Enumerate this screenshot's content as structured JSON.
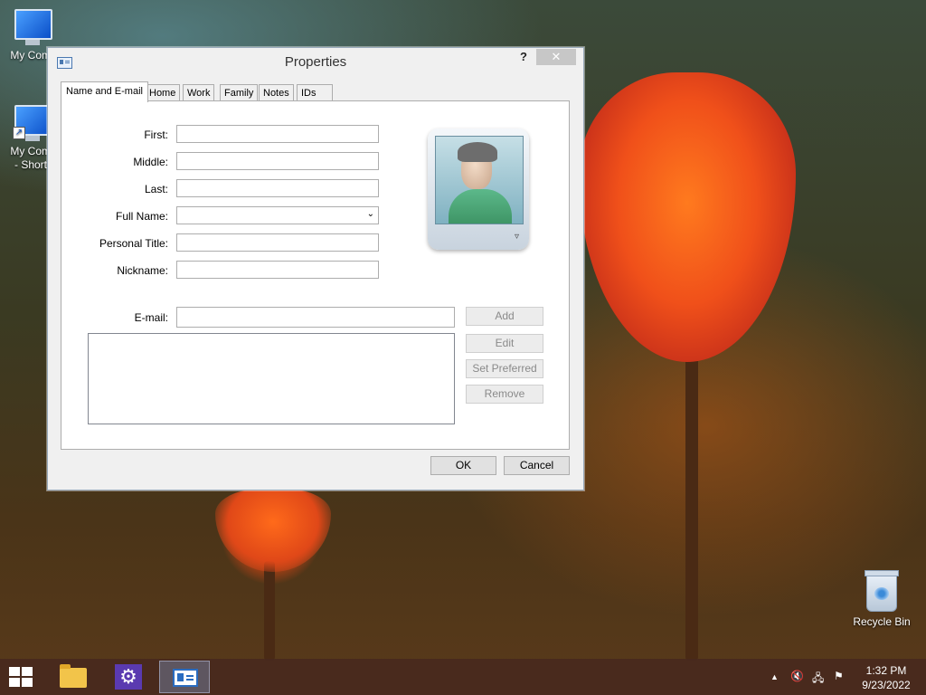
{
  "desktop": {
    "icons": [
      {
        "label": "My Comp"
      },
      {
        "label_line1": "My Comp",
        "label_line2": "- Shortc"
      },
      {
        "label": "Recycle Bin"
      }
    ]
  },
  "dialog": {
    "title": "Properties",
    "help_glyph": "?",
    "close_glyph": "✕",
    "tabs": [
      {
        "label": "Name and E-mail",
        "active": true
      },
      {
        "label": "Home"
      },
      {
        "label": "Work"
      },
      {
        "label": "Family"
      },
      {
        "label": "Notes"
      },
      {
        "label": "IDs"
      }
    ],
    "fields": {
      "first": {
        "label": "First:",
        "value": ""
      },
      "middle": {
        "label": "Middle:",
        "value": ""
      },
      "last": {
        "label": "Last:",
        "value": ""
      },
      "full_name": {
        "label": "Full Name:",
        "value": ""
      },
      "personal_title": {
        "label": "Personal Title:",
        "value": ""
      },
      "nickname": {
        "label": "Nickname:",
        "value": ""
      },
      "email": {
        "label": "E-mail:",
        "value": ""
      }
    },
    "email_buttons": {
      "add": "Add",
      "edit": "Edit",
      "set_preferred": "Set Preferred",
      "remove": "Remove"
    },
    "footer": {
      "ok": "OK",
      "cancel": "Cancel"
    }
  },
  "taskbar": {
    "clock_time": "1:32 PM",
    "clock_date": "9/23/2022",
    "tray_chevron": "▲"
  }
}
